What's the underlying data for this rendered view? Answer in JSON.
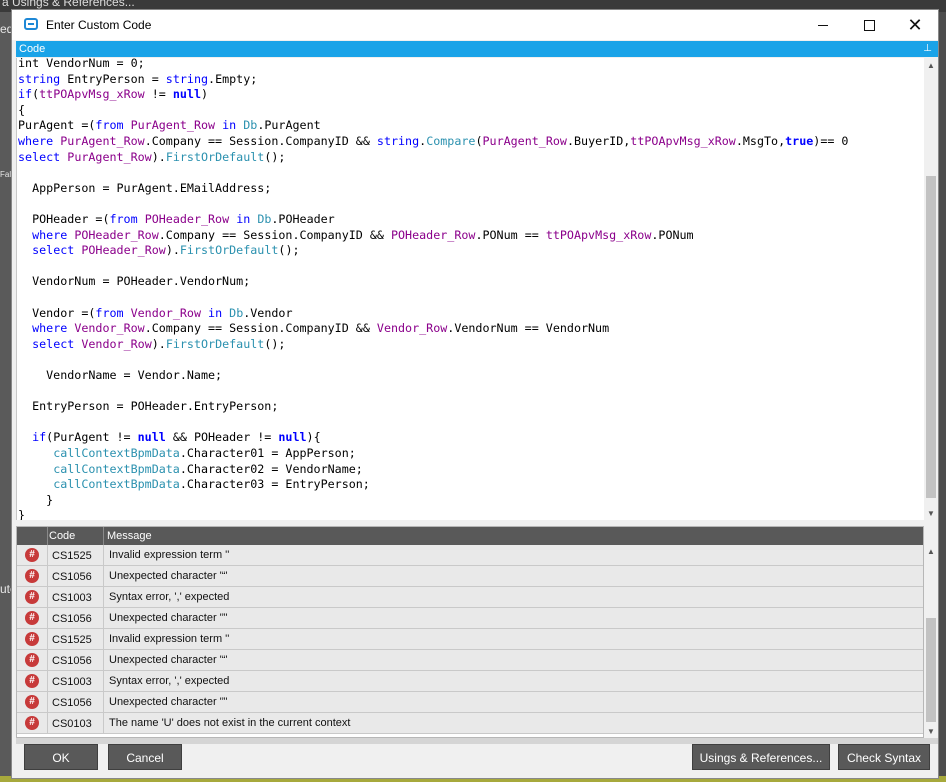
{
  "background": {
    "title_fragment": "a Usings & References...",
    "left_labels": [
      "ed",
      "Fals",
      "ute"
    ]
  },
  "window": {
    "title": "Enter Custom Code",
    "minimize": "—",
    "maximize": "☐",
    "close": "✕"
  },
  "code_panel": {
    "header": "Code",
    "pin_icon": "pin-icon"
  },
  "code_lines": [
    "int VendorNum = 0;",
    "string EntryPerson = string.Empty;",
    "if(ttPOApvMsg_xRow != null)",
    "{",
    "PurAgent =(from PurAgent_Row in Db.PurAgent",
    "where PurAgent_Row.Company == Session.CompanyID && string.Compare(PurAgent_Row.BuyerID,ttPOApvMsg_xRow.MsgTo,true)== 0",
    "select PurAgent_Row).FirstOrDefault();",
    "",
    "  AppPerson = PurAgent.EMailAddress;",
    "",
    "  POHeader =(from POHeader_Row in Db.POHeader",
    "  where POHeader_Row.Company == Session.CompanyID && POHeader_Row.PONum == ttPOApvMsg_xRow.PONum",
    "  select POHeader_Row).FirstOrDefault();",
    "",
    "  VendorNum = POHeader.VendorNum;",
    "",
    "  Vendor =(from Vendor_Row in Db.Vendor",
    "  where Vendor_Row.Company == Session.CompanyID && Vendor_Row.VendorNum == VendorNum",
    "  select Vendor_Row).FirstOrDefault();",
    "",
    "    VendorName = Vendor.Name;",
    "",
    "  EntryPerson = POHeader.EntryPerson;",
    "",
    "  if(PurAgent != null && POHeader != null){",
    "     callContextBpmData.Character01 = AppPerson;",
    "     callContextBpmData.Character02 = VendorName;",
    "     callContextBpmData.Character03 = EntryPerson;",
    "    }",
    "}"
  ],
  "errors_grid": {
    "columns": [
      "Code",
      "Message"
    ],
    "row_icon": "#",
    "rows": [
      {
        "code": "CS1525",
        "message": "Invalid expression term ''"
      },
      {
        "code": "CS1056",
        "message": "Unexpected character '“'"
      },
      {
        "code": "CS1003",
        "message": "Syntax error, ',' expected"
      },
      {
        "code": "CS1056",
        "message": "Unexpected character '”'"
      },
      {
        "code": "CS1525",
        "message": "Invalid expression term ''"
      },
      {
        "code": "CS1056",
        "message": "Unexpected character '“'"
      },
      {
        "code": "CS1003",
        "message": "Syntax error, ',' expected"
      },
      {
        "code": "CS1056",
        "message": "Unexpected character '”'"
      },
      {
        "code": "CS0103",
        "message": "The name 'U' does not exist in the current context"
      }
    ]
  },
  "footer": {
    "ok": "OK",
    "cancel": "Cancel",
    "usings": "Usings & References...",
    "check_syntax": "Check Syntax"
  }
}
